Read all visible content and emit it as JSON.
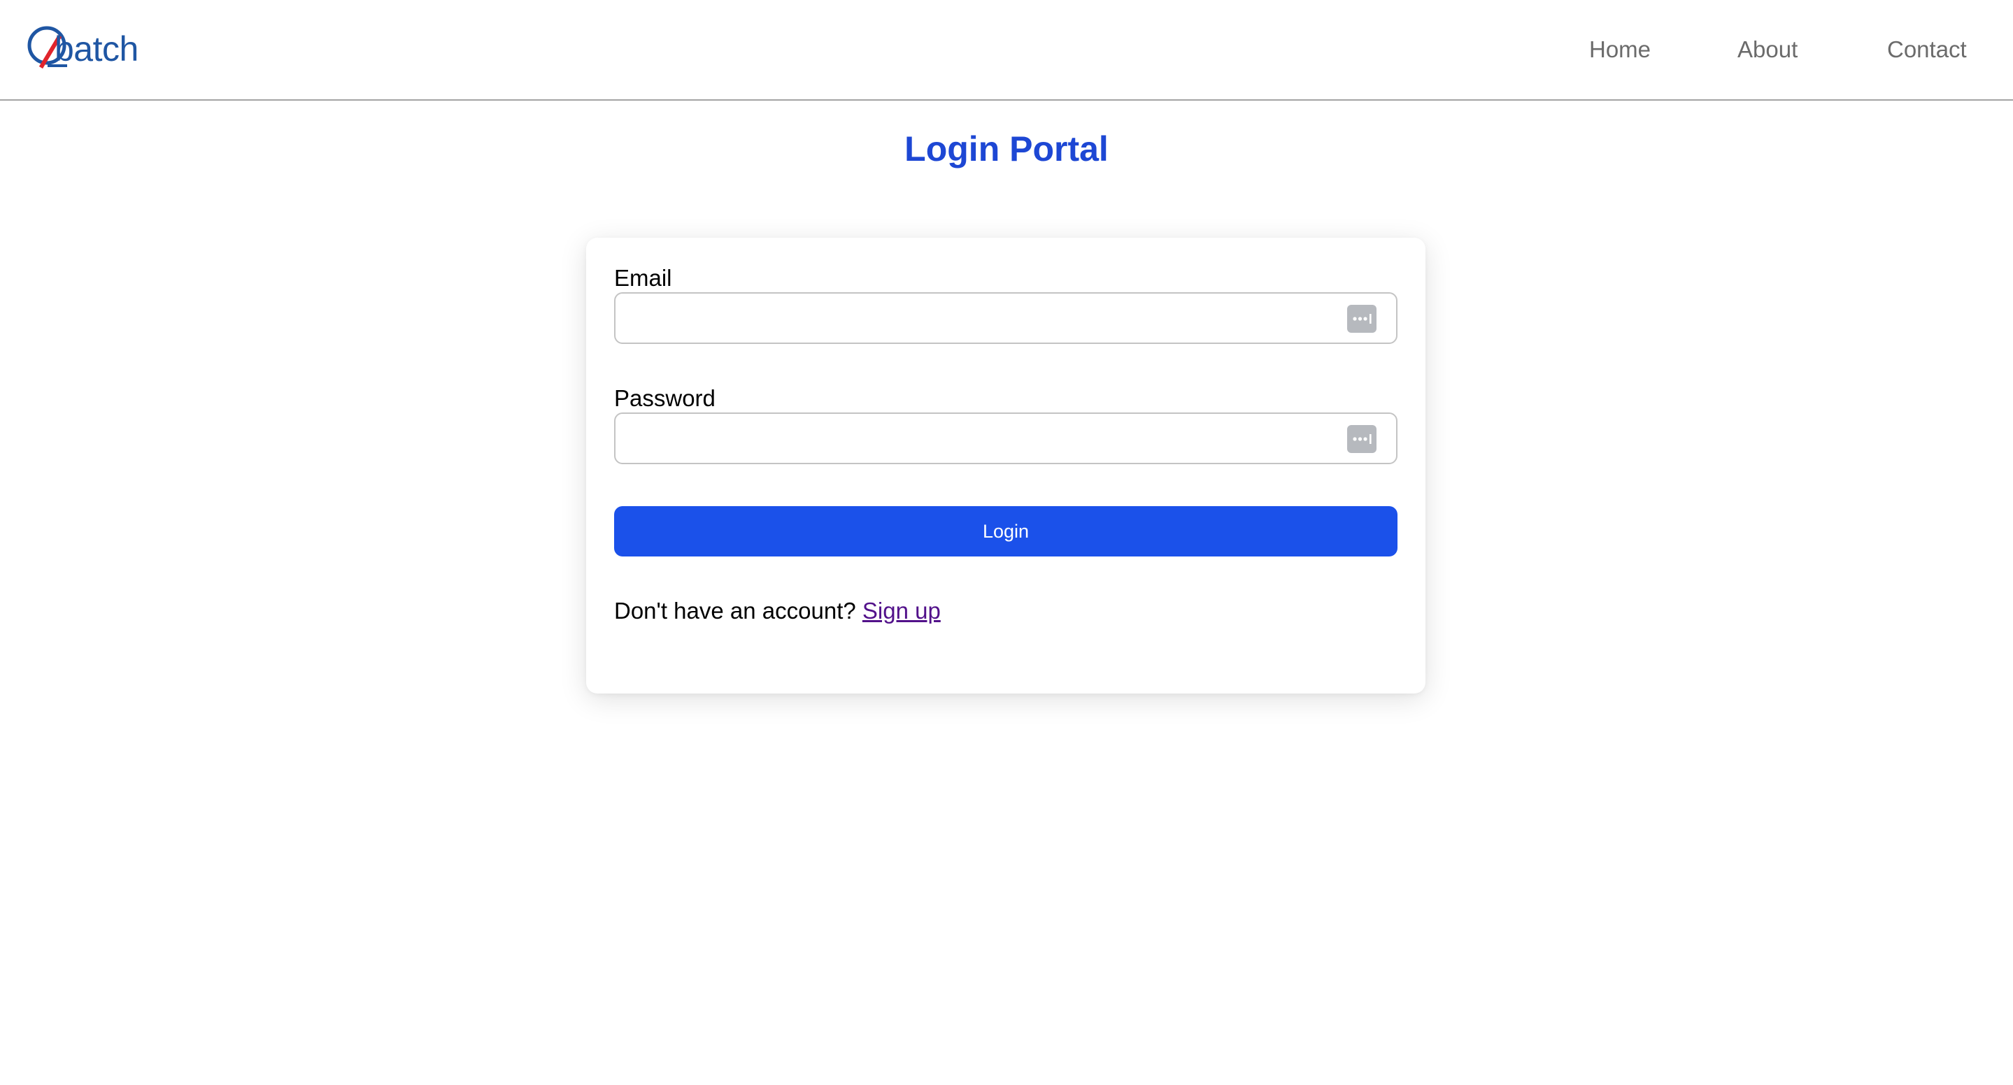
{
  "header": {
    "logo_text": "batch",
    "nav": {
      "home": "Home",
      "about": "About",
      "contact": "Contact"
    }
  },
  "page": {
    "title": "Login Portal"
  },
  "form": {
    "email_label": "Email",
    "email_value": "",
    "password_label": "Password",
    "password_value": "",
    "login_label": "Login",
    "signup_prompt": "Don't have an account?",
    "signup_link": "Sign up"
  },
  "colors": {
    "accent": "#1b51ea",
    "title": "#1d47d4",
    "logo_blue": "#1f56a3",
    "logo_red": "#e0242c",
    "link_visited": "#52118a"
  },
  "icons": {
    "logo_mark": "q-logo-icon",
    "field_autofill": "password-manager-icon"
  }
}
